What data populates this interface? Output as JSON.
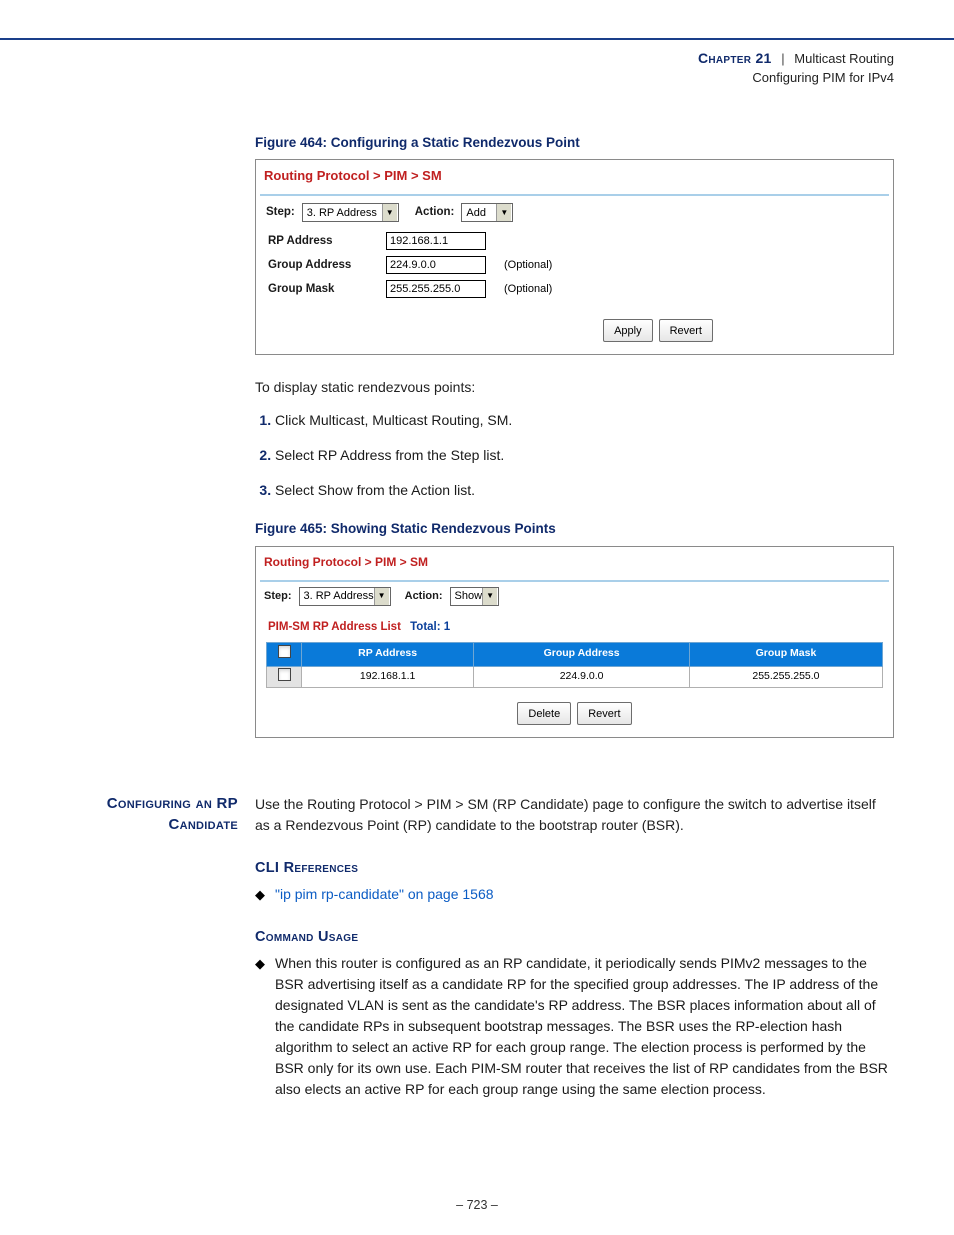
{
  "header": {
    "chapter": "Chapter 21",
    "title": "Multicast Routing",
    "subtitle": "Configuring PIM for IPv4"
  },
  "figure1": {
    "caption": "Figure 464:  Configuring a Static Rendezvous Point",
    "breadcrumb": "Routing Protocol > PIM >  SM",
    "step_label": "Step:",
    "step_value": "3. RP Address",
    "action_label": "Action:",
    "action_value": "Add",
    "fields": {
      "rp_label": "RP Address",
      "rp_value": "192.168.1.1",
      "ga_label": "Group Address",
      "ga_value": "224.9.0.0",
      "ga_note": "(Optional)",
      "gm_label": "Group Mask",
      "gm_value": "255.255.255.0",
      "gm_note": "(Optional)"
    },
    "buttons": {
      "apply": "Apply",
      "revert": "Revert"
    }
  },
  "para_display": "To display static rendezvous points:",
  "steps_display": [
    "Click Multicast, Multicast Routing, SM.",
    "Select RP Address from the Step list.",
    "Select Show from the Action list."
  ],
  "figure2": {
    "caption": "Figure 465:  Showing Static Rendezvous Points",
    "breadcrumb": "Routing Protocol > PIM >  SM",
    "step_label": "Step:",
    "step_value": "3. RP Address",
    "action_label": "Action:",
    "action_value": "Show",
    "list_title": "PIM-SM RP Address List",
    "list_total_label": "Total: 1",
    "columns": {
      "c1": "RP Address",
      "c2": "Group Address",
      "c3": "Group Mask"
    },
    "row": {
      "c1": "192.168.1.1",
      "c2": "224.9.0.0",
      "c3": "255.255.255.0"
    },
    "buttons": {
      "delete": "Delete",
      "revert": "Revert"
    }
  },
  "rp_candidate": {
    "sidetitle_line1": "Configuring an RP",
    "sidetitle_line2": "Candidate",
    "intro": "Use the Routing Protocol > PIM > SM (RP Candidate) page to configure the switch to advertise itself as a Rendezvous Point (RP) candidate to the bootstrap router (BSR).",
    "cli_head": "CLI References",
    "cli_link": "\"ip pim rp-candidate\" on page 1568",
    "usage_head": "Command Usage",
    "usage_text": "When this router is configured as an RP candidate, it periodically sends PIMv2 messages to the BSR advertising itself as a candidate RP for the specified group addresses. The IP address of the designated VLAN is sent as the candidate's RP address. The BSR places information about all of the candidate RPs in subsequent bootstrap messages. The BSR uses the RP-election hash algorithm to select an active RP for each group range. The election process is performed by the BSR only for its own use. Each PIM-SM router that receives the list of RP candidates from the BSR also elects an active RP for each group range using the same election process."
  },
  "page_number": "–  723  –"
}
